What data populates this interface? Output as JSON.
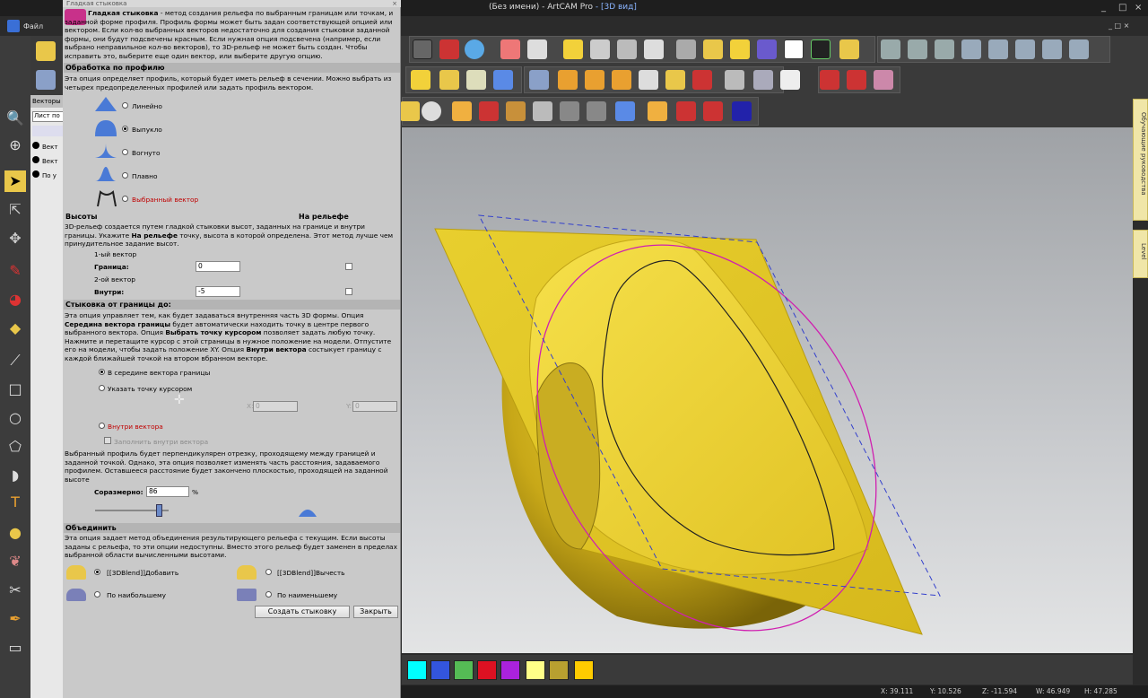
{
  "window": {
    "title_prefix": "(Без имени) - ",
    "app": "ArtCAM Pro",
    "view": " - [3D вид]",
    "dialog_caption": "Гладкая стыковка",
    "sub_controls": "_ □ ×"
  },
  "menu": {
    "file": "Файл"
  },
  "dialog": {
    "intro_bold": "Гладкая стыковка",
    "intro_text": " - метод создания рельефа по выбранным границам или точкам, и заданной форме профиля. Профиль формы может быть задан соответствующей опцией или вектором. Если кол-во выбранных векторов недостаточно для создания стыковки заданной формы, они будут подсвечены красным. Если нужная опция подсвечена (например, если выбрано неправильное кол-во векторов), то 3D-рельеф не может быть создан. Чтобы исправить это, выберите еще один вектор, или выберите другую опцию.",
    "profile": {
      "header": "Обработка по профилю",
      "desc": "Эта опция определяет профиль, который будет иметь рельеф в сечении. Можно выбрать из четырех предопределенных профилей или задать профиль вектором.",
      "options": [
        "Линейно",
        "Выпукло",
        "Вогнуто",
        "Плавно",
        "Выбранный вектор"
      ]
    },
    "heights": {
      "header": "Высоты",
      "header_right": "На рельефе",
      "desc_a": "3D-рельеф создается путем гладкой стыковки высот, заданных на границе и внутри границы. Укажите ",
      "desc_bold": "На рельефе",
      "desc_b": " точку, высота в которой определена. Этот метод лучше чем принудительное задание высот.",
      "vec1": "1-ый вектор",
      "border_label": "Граница:",
      "border_value": "0",
      "vec2": "2-ой вектор",
      "inside_label": "Внутри:",
      "inside_value": "-5"
    },
    "blend": {
      "header": "Стыковка от границы до:",
      "desc_1": "Эта опция управляет тем, как будет задаваться внутренняя часть 3D формы. Опция ",
      "desc_b1": "Середина вектора границы",
      "desc_2": " будет автоматически находить точку в центре первого выбранного вектора. Опция ",
      "desc_b2": "Выбрать точку курсором",
      "desc_3": " позволяет задать любую точку. Нажмите и перетащите курсор с этой страницы в нужное положение на модели. Отпустите его на модели, чтобы задать положение XY. Опция ",
      "desc_b3": "Внутри вектора",
      "desc_4": " состыкует границу с каждой ближайшей точкой на втором вбранном векторе.",
      "opt_mid": "В середине вектора границы",
      "opt_cursor": "Указать точку курсором",
      "x_label": "X:",
      "x_value": "0",
      "y_label": "Y:",
      "y_value": "0",
      "opt_inside": "Внутри вектора",
      "fill_inside": "Заполнить внутри вектора",
      "desc_prof": "Выбранный профиль будет перпендикулярен отрезку, проходящему между границей и заданной точкой. Однако, эта опция позволяет изменять часть расстояния, задаваемого профилем. Оставшееся расстояние будет закончено плоскостью, проходящей на заданной высоте",
      "prop_label": "Соразмерно:",
      "prop_value": "86",
      "prop_unit": "%",
      "slider_fraction": 0.86
    },
    "combine": {
      "header": "Объединить",
      "desc": "Эта опция задает метод объединения результирующего рельефа с текущим. Если высоты заданы с рельефа, то эти опции недоступны. Вместо этого рельеф будет заменен в пределах выбранной области вычисленными высотами.",
      "add": "[[3DBlend]]Добавить",
      "subtract": "[[3DBlend]]Вычесть",
      "max": "По наибольшему",
      "min": "По наименьшему"
    },
    "buttons": {
      "create": "Создать стыковку",
      "close": "Закрыть"
    }
  },
  "vector_panel": {
    "tab": "Векторы",
    "sheet": "Лист по",
    "items": [
      "Вект",
      "Вект",
      "По у"
    ]
  },
  "right_tabs": [
    "Обучающие руководства",
    "Level"
  ],
  "palette": {
    "colors": [
      "#00ffff",
      "#3355dd",
      "#55bb55",
      "#dd1122",
      "#aa22dd",
      "#ffff88",
      "#b8a030",
      "#ffcc00"
    ]
  },
  "status": {
    "x": "X: 39.111",
    "y": "Y: 10.526",
    "z": "Z: -11.594",
    "w": "W: 46.949",
    "h": "H: 47.285"
  },
  "colors": {
    "relief": "#e6c82a",
    "accent": "#8ab4ff"
  }
}
